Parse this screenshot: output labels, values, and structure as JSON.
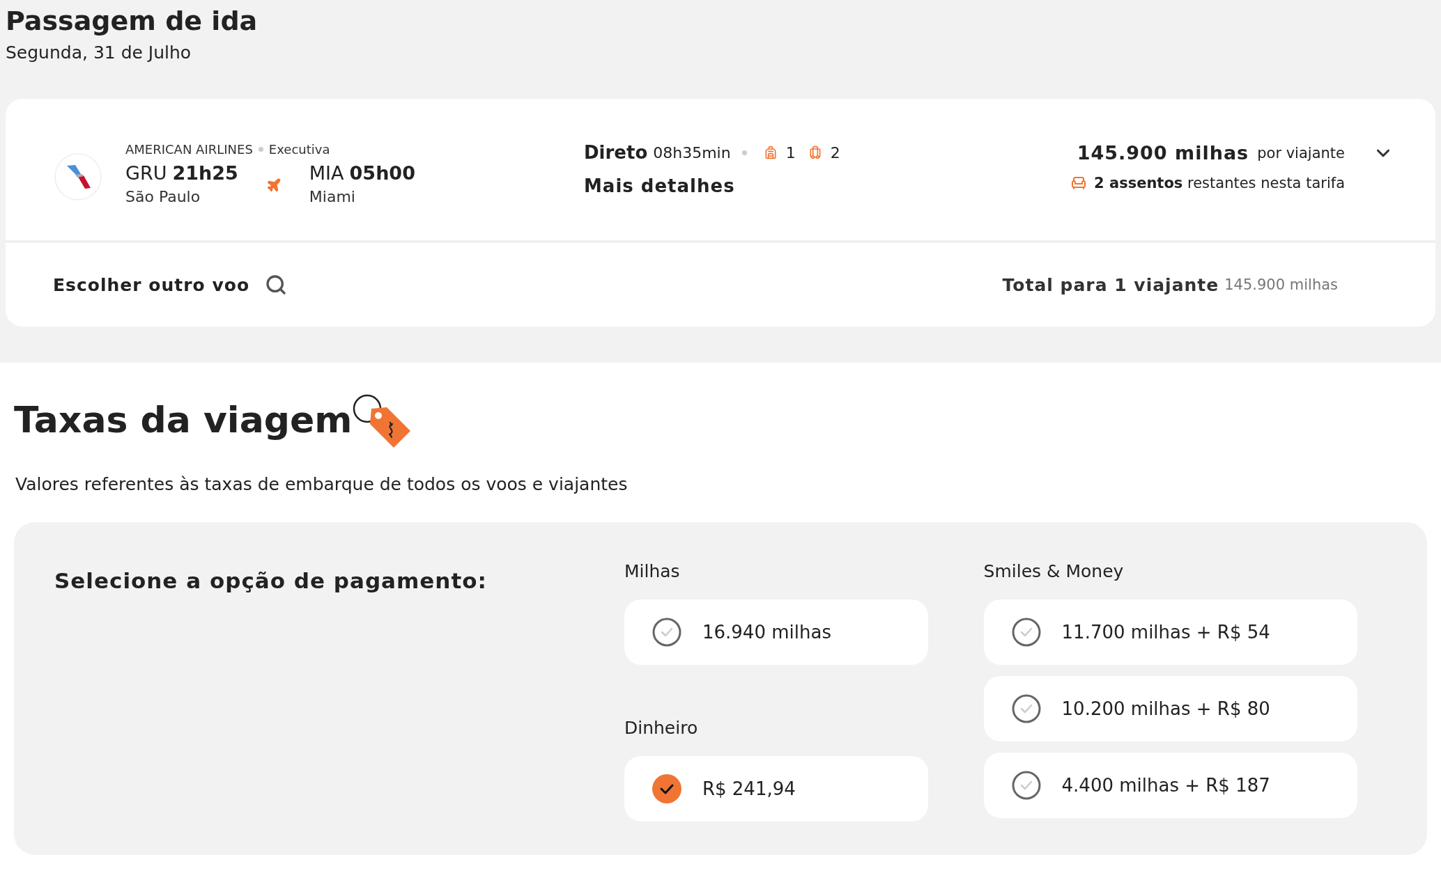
{
  "header": {
    "title": "Passagem de ida",
    "date": "Segunda, 31 de Julho"
  },
  "flight": {
    "airline": "AMERICAN AIRLINES",
    "cabin": "Executiva",
    "origin": {
      "code": "GRU",
      "time": "21h25",
      "city": "São Paulo"
    },
    "destination": {
      "code": "MIA",
      "time": "05h00",
      "city": "Miami"
    },
    "stop_type": "Direto",
    "duration": "08h35min",
    "carry_on": "1",
    "checked_bags": "2",
    "details_link": "Mais detalhes",
    "price": "145.900 milhas",
    "price_unit": "por viajante",
    "seats": "**2 assentos** restantes nesta tarifa",
    "expanded": false
  },
  "footer": {
    "change_flight": "Escolher outro voo",
    "total_label": "Total para 1 viajante",
    "total_value": "145.900 milhas"
  },
  "fees": {
    "title": "Taxas da viagem",
    "description": "Valores referentes às taxas de embarque de todos os voos e viajantes",
    "payment_prompt": "Selecione a opção de pagamento:",
    "columns": [
      {
        "groups": [
          {
            "label": "Milhas",
            "options": [
              {
                "label": "16.940 milhas",
                "selected": false
              }
            ]
          },
          {
            "label": "Dinheiro",
            "options": [
              {
                "label": "R$ 241,94",
                "selected": true
              }
            ]
          }
        ]
      },
      {
        "groups": [
          {
            "label": "Smiles & Money",
            "options": [
              {
                "label": "11.700 milhas + R$ 54",
                "selected": false
              },
              {
                "label": "10.200 milhas + R$ 80",
                "selected": false
              },
              {
                "label": "4.400 milhas + R$ 187",
                "selected": false
              }
            ]
          }
        ]
      }
    ]
  }
}
